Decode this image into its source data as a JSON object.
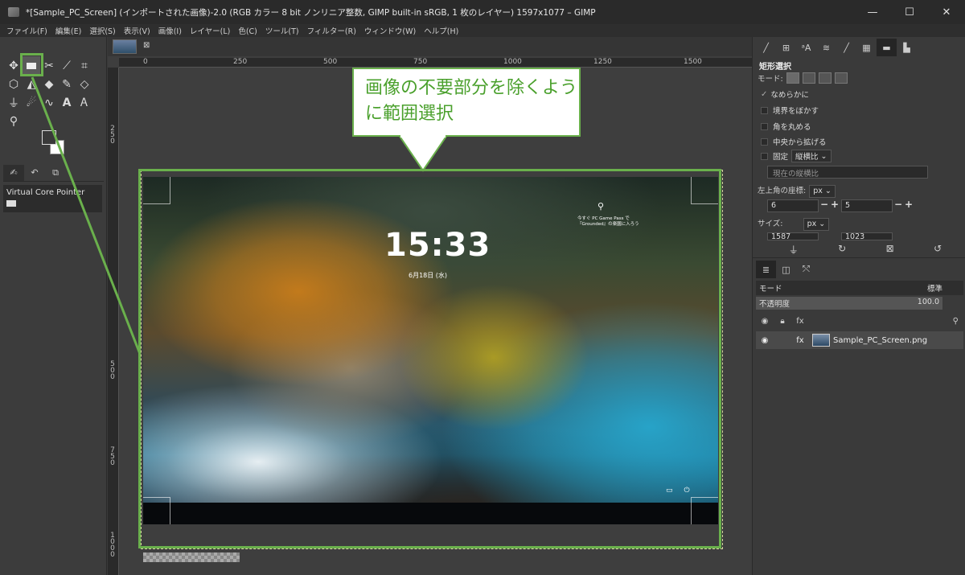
{
  "window": {
    "title": "*[Sample_PC_Screen] (インポートされた画像)-2.0 (RGB カラー 8 bit ノンリニア整数, GIMP built-in sRGB, 1 枚のレイヤー) 1597x1077 – GIMP",
    "minimize": "—",
    "maximize": "☐",
    "close": "✕"
  },
  "menu": [
    "ファイル(F)",
    "編集(E)",
    "選択(S)",
    "表示(V)",
    "画像(I)",
    "レイヤー(L)",
    "色(C)",
    "ツール(T)",
    "フィルター(R)",
    "ウィンドウ(W)",
    "ヘルプ(H)"
  ],
  "toolbox": {
    "tools": [
      "move-icon",
      "rect-select-icon",
      "cut-icon",
      "fuzzy-select-icon",
      "crop-icon",
      "transform-icon",
      "bucket-icon",
      "fill-icon",
      "paintbrush-icon",
      "eraser-icon",
      "clone-icon",
      "smudge-icon",
      "path-icon",
      "text-icon",
      "text-tool-icon",
      "zoom-icon"
    ],
    "device_label": "Virtual Core Pointer"
  },
  "canvas": {
    "ruler_h": [
      "0",
      "250",
      "500",
      "750",
      "1000",
      "1250",
      "1500"
    ],
    "ruler_v": [
      "2\n5\n0",
      "5\n0\n0",
      "7\n5\n0",
      "1\n0\n0\n0"
    ],
    "lock_time": "15:33",
    "lock_date": "6月18日 (水)",
    "widget_text": "今すぐ PC Game Pass で『Grounded』の楽園に入ろう",
    "callout": "画像の不要部分を除くように範囲選択"
  },
  "tool_options": {
    "title": "矩形選択",
    "mode_label": "モード:",
    "antialias": "なめらかに",
    "feather": "境界をぼかす",
    "rounded": "角を丸める",
    "expand_center": "中央から拡げる",
    "fixed": "固定",
    "fixed_value": "縦横比",
    "aspect_placeholder": "現在の縦横比",
    "position_label": "左上角の座標:",
    "unit": "px",
    "pos_x": "6",
    "pos_y": "5",
    "size_label": "サイズ:",
    "size_w": "1587",
    "size_h": "1023"
  },
  "layers": {
    "mode_label": "モード",
    "mode_value": "標準",
    "opacity_label": "不透明度",
    "opacity_value": "100.0",
    "layer_name": "Sample_PC_Screen.png"
  },
  "colors": {
    "accent_green": "#6ab04c"
  }
}
